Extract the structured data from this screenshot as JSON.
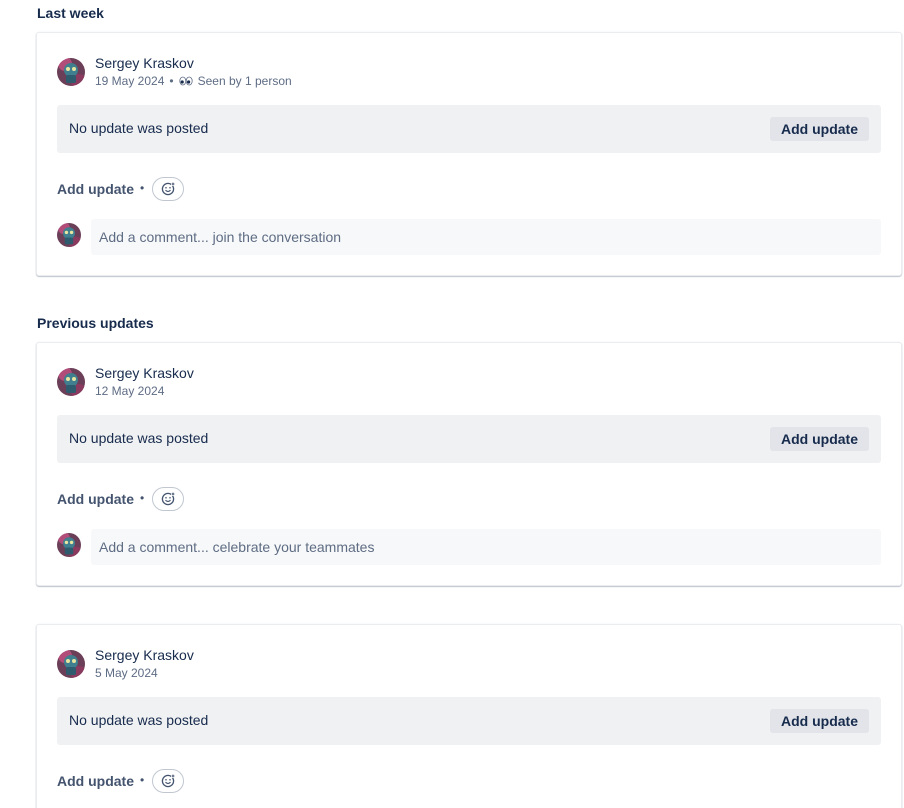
{
  "sections": [
    {
      "heading": "Last week"
    },
    {
      "heading": "Previous updates"
    }
  ],
  "cards": [
    {
      "author": "Sergey Kraskov",
      "date": "19 May 2024",
      "seen_by": "Seen by 1 person",
      "update_text": "No update was posted",
      "add_update_button": "Add update",
      "add_update_link": "Add update",
      "comment_placeholder": "Add a comment... join the conversation"
    },
    {
      "author": "Sergey Kraskov",
      "date": "12 May 2024",
      "update_text": "No update was posted",
      "add_update_button": "Add update",
      "add_update_link": "Add update",
      "comment_placeholder": "Add a comment... celebrate your teammates"
    },
    {
      "author": "Sergey Kraskov",
      "date": "5 May 2024",
      "update_text": "No update was posted",
      "add_update_button": "Add update",
      "add_update_link": "Add update"
    }
  ],
  "separator": "•",
  "icons": {
    "seen": "eyes-icon",
    "reaction": "emoji-add-icon",
    "avatar": "user-avatar"
  },
  "colors": {
    "text": "#172b4d",
    "subtle_text": "#5e6c84",
    "box_background": "#f0f1f3",
    "button_background": "#e2e4e9"
  }
}
